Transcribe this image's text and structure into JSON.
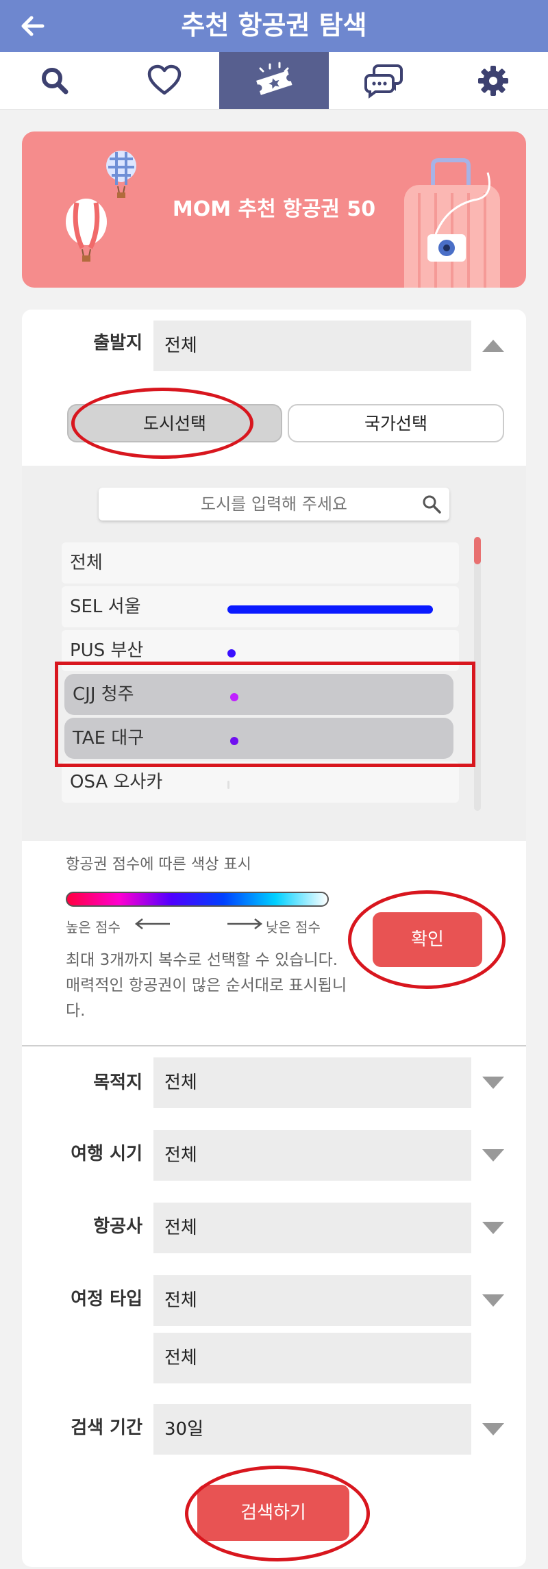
{
  "header": {
    "title": "추천 항공권 탐색"
  },
  "tabs": [
    {
      "icon": "search-icon"
    },
    {
      "icon": "heart-icon"
    },
    {
      "icon": "ticket-icon",
      "active": true
    },
    {
      "icon": "chat-icon"
    },
    {
      "icon": "gear-icon"
    }
  ],
  "banner": {
    "title": "MOM 추천 항공권 50"
  },
  "origin": {
    "label": "출발지",
    "value": "전체"
  },
  "segments": {
    "city": "도시선택",
    "country": "국가선택"
  },
  "city_search": {
    "placeholder": "도시를 입력해 주세요"
  },
  "city_list": [
    {
      "label": "전체",
      "score": 0,
      "color": "",
      "selected": false
    },
    {
      "label": "SEL 서울",
      "score": 1.0,
      "color": "#0a1aff",
      "selected": false
    },
    {
      "label": "PUS 부산",
      "score": 0.02,
      "color": "#3a10ff",
      "selected": false
    },
    {
      "label": "CJJ 청주",
      "score": 0.015,
      "color": "#c020ff",
      "selected": true
    },
    {
      "label": "TAE 대구",
      "score": 0.015,
      "color": "#7010f0",
      "selected": true
    },
    {
      "label": "OSA 오사카",
      "score": 0.005,
      "color": "#e0e0e0",
      "selected": false
    }
  ],
  "legend": {
    "caption": "항공권 점수에 따른 색상 표시",
    "high": "높은 점수",
    "low": "낮은 점수"
  },
  "notice": "최대 3개까지 복수로 선택할 수 있습니다. 매력적인 항공권이 많은 순서대로 표시됩니다.",
  "confirm_label": "확인",
  "fields": {
    "destination": {
      "label": "목적지",
      "value": "전체"
    },
    "period": {
      "label": "여행 시기",
      "value": "전체"
    },
    "airline": {
      "label": "항공사",
      "value": "전체"
    },
    "trip_type": {
      "label": "여정 타입",
      "value": "전체",
      "value2": "전체"
    },
    "search_range": {
      "label": "검색 기간",
      "value": "30일"
    }
  },
  "search_button": "검색하기",
  "colors": {
    "header": "#6e87cf",
    "accent": "#e85353",
    "banner": "#f58c8c",
    "highlight": "#d8161e"
  }
}
